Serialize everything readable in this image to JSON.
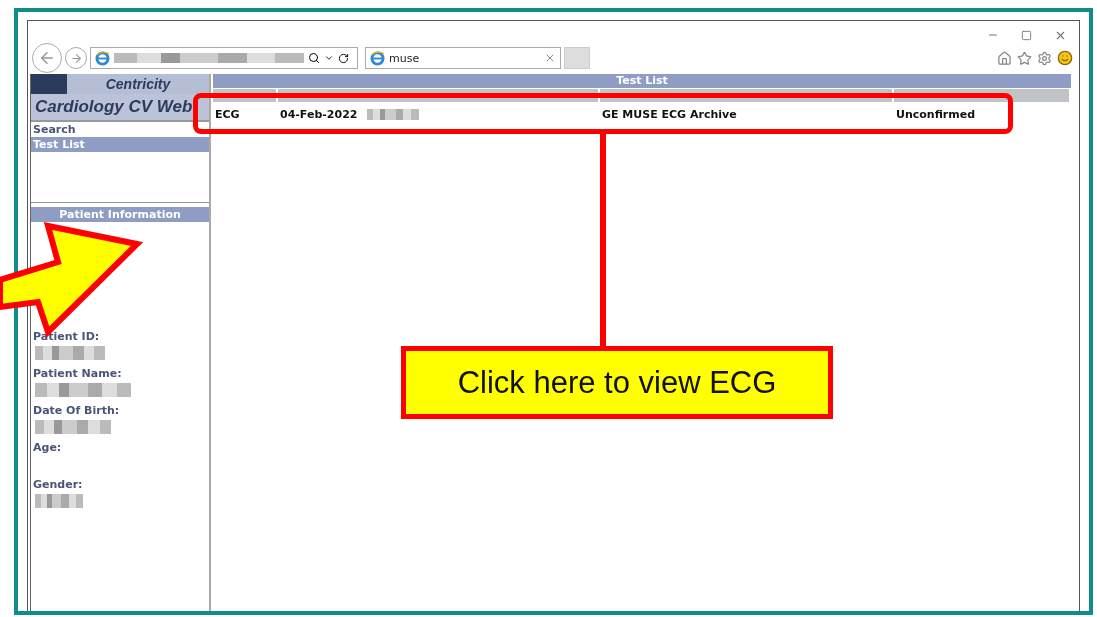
{
  "browser": {
    "tab": {
      "title": "muse"
    }
  },
  "sidebar": {
    "logo": {
      "line_1": "Centricity",
      "line_2": "Cardiology CV Web"
    },
    "nav": [
      {
        "label": "Search",
        "selected": false
      },
      {
        "label": "Test List",
        "selected": true
      }
    ],
    "patient_panel": {
      "title": "Patient Information",
      "fields": [
        {
          "label": "Patient ID:",
          "redacted": true
        },
        {
          "label": "Patient Name:",
          "redacted": true
        },
        {
          "label": "Date Of Birth:",
          "redacted": true
        },
        {
          "label": "Age:",
          "redacted": false
        },
        {
          "label": "Gender:",
          "redacted": true
        }
      ]
    }
  },
  "main": {
    "title": "Test List",
    "rows": [
      {
        "test": "ECG",
        "date": "04-Feb-2022",
        "time_redacted": true,
        "host_server": "GE MUSE ECG Archive",
        "status": "Unconfirmed"
      }
    ]
  },
  "annotation": {
    "callout": "Click here to view ECG"
  }
}
